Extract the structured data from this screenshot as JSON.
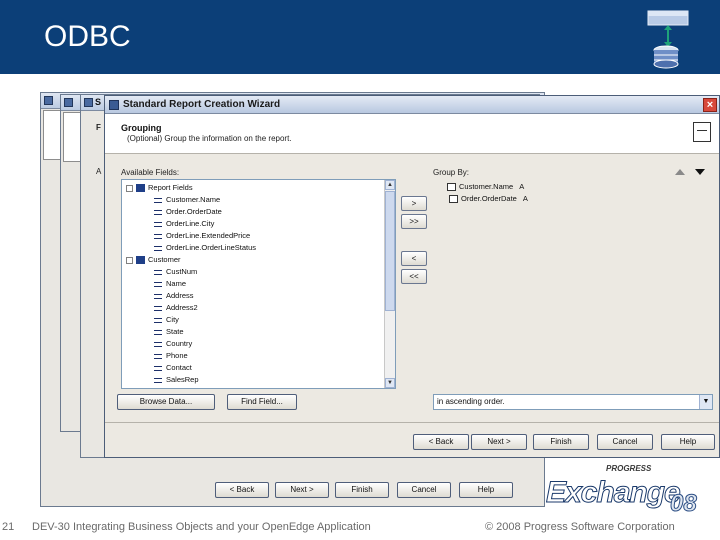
{
  "slide": {
    "title": "ODBC",
    "page_number": "21",
    "footer_left": "DEV-30 Integrating Business Objects and your OpenEdge Application",
    "footer_right": "© 2008 Progress Software Corporation"
  },
  "back_windows": {
    "title_fragment": "S",
    "side_letter_1": "F",
    "side_letter_2": "A",
    "buttons": [
      "< Back",
      "Next >",
      "Finish",
      "Cancel",
      "Help"
    ]
  },
  "wizard": {
    "title": "Standard Report Creation Wizard",
    "close": "×",
    "section_title": "Grouping",
    "section_desc": "(Optional) Group the information on the report.",
    "available_label": "Available Fields:",
    "group_by_label": "Group By:",
    "available_fields": [
      {
        "label": "Report Fields",
        "level": 0,
        "kind": "folder"
      },
      {
        "label": "Customer.Name",
        "level": 1,
        "kind": "field"
      },
      {
        "label": "Order.OrderDate",
        "level": 1,
        "kind": "field"
      },
      {
        "label": "OrderLine.City",
        "level": 1,
        "kind": "field"
      },
      {
        "label": "OrderLine.ExtendedPrice",
        "level": 1,
        "kind": "field"
      },
      {
        "label": "OrderLine.OrderLineStatus",
        "level": 1,
        "kind": "field"
      },
      {
        "label": "Customer",
        "level": 0,
        "kind": "table"
      },
      {
        "label": "CustNum",
        "level": 1,
        "kind": "field"
      },
      {
        "label": "Name",
        "level": 1,
        "kind": "field"
      },
      {
        "label": "Address",
        "level": 1,
        "kind": "field"
      },
      {
        "label": "Address2",
        "level": 1,
        "kind": "field"
      },
      {
        "label": "City",
        "level": 1,
        "kind": "field"
      },
      {
        "label": "State",
        "level": 1,
        "kind": "field"
      },
      {
        "label": "Country",
        "level": 1,
        "kind": "field"
      },
      {
        "label": "Phone",
        "level": 1,
        "kind": "field"
      },
      {
        "label": "Contact",
        "level": 1,
        "kind": "field"
      },
      {
        "label": "SalesRep",
        "level": 1,
        "kind": "field"
      }
    ],
    "group_by": [
      {
        "label": "Customer.Name",
        "suffix": "A"
      },
      {
        "label": "Order.OrderDate",
        "suffix": "A"
      }
    ],
    "move_buttons": [
      ">",
      ">>",
      "<",
      "<<"
    ],
    "browse_button": "Browse Data...",
    "find_button": "Find Field...",
    "sort_order": "in ascending order.",
    "buttons": {
      "back": "< Back",
      "next": "Next >",
      "finish": "Finish",
      "cancel": "Cancel",
      "help": "Help"
    }
  },
  "brand": {
    "progress": "PROGRESS",
    "exchange": "Exchange",
    "year": "08"
  }
}
